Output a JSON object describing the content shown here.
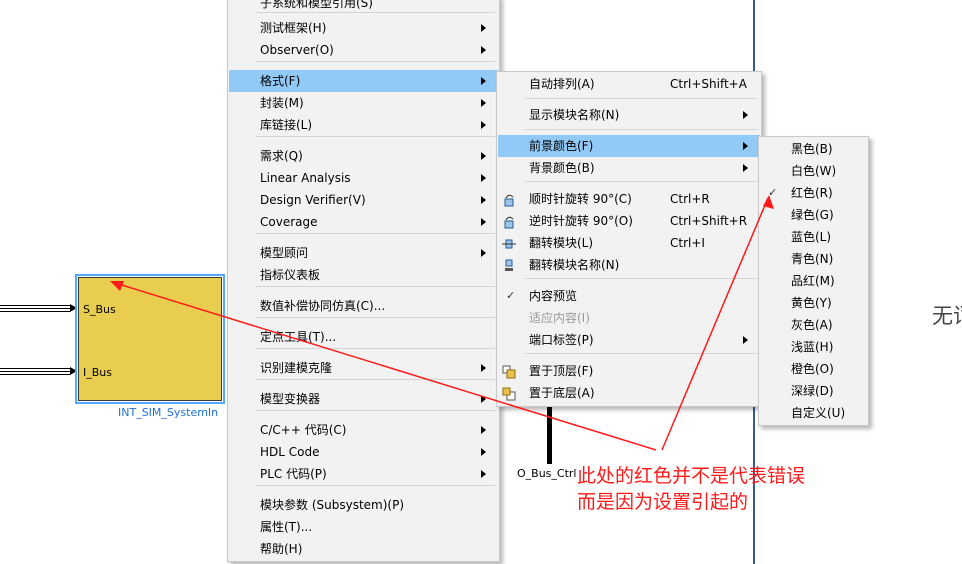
{
  "canvas": {
    "block": {
      "in_ports": [
        "S_Bus",
        "I_Bus"
      ],
      "name": "INT_SIM_SystemIn"
    },
    "output_label": "O_Bus_Ctrl",
    "right_text": "无词"
  },
  "context_menu": {
    "clipped_top_label": "子系统和模型引用(S)",
    "items": [
      {
        "label": "测试框架(H)",
        "submenu": true
      },
      {
        "label": "Observer(O)",
        "submenu": true
      },
      {
        "label": "格式(F)",
        "submenu": true,
        "highlighted": true
      },
      {
        "label": "封装(M)",
        "submenu": true
      },
      {
        "label": "库链接(L)",
        "submenu": true
      },
      {
        "label": "需求(Q)",
        "submenu": true
      },
      {
        "label": "Linear Analysis",
        "submenu": true
      },
      {
        "label": "Design Verifier(V)",
        "submenu": true
      },
      {
        "label": "Coverage",
        "submenu": true
      },
      {
        "label": "模型顾问",
        "submenu": true
      },
      {
        "label": "指标仪表板",
        "submenu": false
      },
      {
        "label": "数值补偿协同仿真(C)...",
        "submenu": false
      },
      {
        "label": "定点工具(T)...",
        "submenu": false
      },
      {
        "label": "识别建模克隆",
        "submenu": true
      },
      {
        "label": "模型变换器",
        "submenu": true
      },
      {
        "label": "C/C++ 代码(C)",
        "submenu": true
      },
      {
        "label": "HDL Code",
        "submenu": true
      },
      {
        "label": "PLC 代码(P)",
        "submenu": true
      },
      {
        "label": "模块参数 (Subsystem)(P)",
        "submenu": false
      },
      {
        "label": "属性(T)...",
        "submenu": false
      },
      {
        "label": "帮助(H)",
        "submenu": false
      }
    ]
  },
  "format_menu": {
    "items": [
      {
        "label": "自动排列(A)",
        "shortcut": "Ctrl+Shift+A"
      },
      {
        "label": "显示模块名称(N)",
        "shortcut": "",
        "submenu": true
      },
      {
        "label": "前景颜色(F)",
        "shortcut": "",
        "submenu": true,
        "highlighted": true
      },
      {
        "label": "背景颜色(B)",
        "shortcut": "",
        "submenu": true
      },
      {
        "label": "顺时针旋转 90°(C)",
        "shortcut": "Ctrl+R",
        "icon": "rotate-clockwise-icon"
      },
      {
        "label": "逆时针旋转 90°(O)",
        "shortcut": "Ctrl+Shift+R",
        "icon": "rotate-counterclockwise-icon"
      },
      {
        "label": "翻转模块(L)",
        "shortcut": "Ctrl+I",
        "icon": "flip-block-icon"
      },
      {
        "label": "翻转模块名称(N)",
        "shortcut": "",
        "icon": "flip-name-icon"
      },
      {
        "label": "内容预览",
        "shortcut": "",
        "checked": true
      },
      {
        "label": "适应内容(I)",
        "shortcut": "",
        "disabled": true
      },
      {
        "label": "端口标签(P)",
        "shortcut": "",
        "submenu": true
      },
      {
        "label": "置于顶层(F)",
        "shortcut": "",
        "icon": "bring-to-front-icon"
      },
      {
        "label": "置于底层(A)",
        "shortcut": "",
        "icon": "send-to-back-icon"
      }
    ]
  },
  "color_menu": {
    "items": [
      {
        "label": "黑色(B)"
      },
      {
        "label": "白色(W)"
      },
      {
        "label": "红色(R)",
        "checked": true
      },
      {
        "label": "绿色(G)"
      },
      {
        "label": "蓝色(L)"
      },
      {
        "label": "青色(N)"
      },
      {
        "label": "品红(M)"
      },
      {
        "label": "黄色(Y)"
      },
      {
        "label": "灰色(A)"
      },
      {
        "label": "浅蓝(H)"
      },
      {
        "label": "橙色(O)"
      },
      {
        "label": "深绿(D)"
      },
      {
        "label": "自定义(U)"
      }
    ]
  },
  "annotation": {
    "line1": "此处的红色并不是代表错误",
    "line2": "而是因为设置引起的",
    "color": "#ff1a1a"
  },
  "colors": {
    "highlight": "#91c9f7",
    "block_fill": "#e8cd4f",
    "selection_border": "#55a8ff",
    "block_name": "#1e6fd6"
  }
}
